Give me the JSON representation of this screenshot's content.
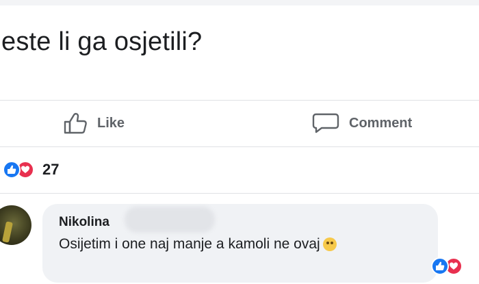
{
  "post": {
    "text": "este li ga osjetili?"
  },
  "actions": {
    "like_label": "Like",
    "comment_label": "Comment"
  },
  "reactions": {
    "count": "27",
    "types": [
      "like-icon",
      "love-icon"
    ]
  },
  "comment": {
    "author": "Nikolina",
    "text": "Osijetim i one naj manje a kamoli ne ovaj",
    "emoji": "astonished-face-emoji",
    "reactions": [
      "like-icon",
      "love-icon"
    ]
  },
  "colors": {
    "like_blue": "#1877f2",
    "love_red": "#e8304f",
    "bubble_bg": "#f0f2f5",
    "text_primary": "#1c1e21",
    "text_secondary": "#5f6368"
  }
}
